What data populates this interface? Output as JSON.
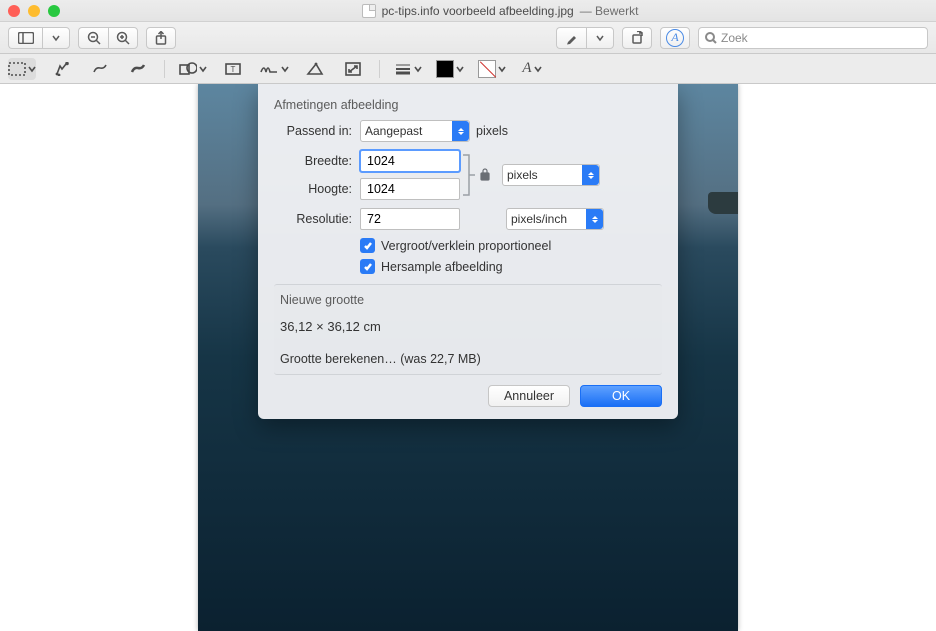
{
  "titlebar": {
    "filename": "pc-tips.info voorbeeld afbeelding.jpg",
    "status": "— Bewerkt"
  },
  "toolbar": {
    "search_placeholder": "Zoek"
  },
  "dialog": {
    "section_dimensions": "Afmetingen afbeelding",
    "fit_label": "Passend in:",
    "fit_value": "Aangepast",
    "fit_unit": "pixels",
    "width_label": "Breedte:",
    "width_value": "1024",
    "height_label": "Hoogte:",
    "height_value": "1024",
    "dim_unit": "pixels",
    "res_label": "Resolutie:",
    "res_value": "72",
    "res_unit": "pixels/inch",
    "scale_proportional": "Vergroot/verklein proportioneel",
    "resample": "Hersample afbeelding",
    "newsize_label": "Nieuwe grootte",
    "newsize_value": "36,12 × 36,12 cm",
    "calc": "Grootte berekenen… (was 22,7 MB)",
    "cancel": "Annuleer",
    "ok": "OK"
  }
}
